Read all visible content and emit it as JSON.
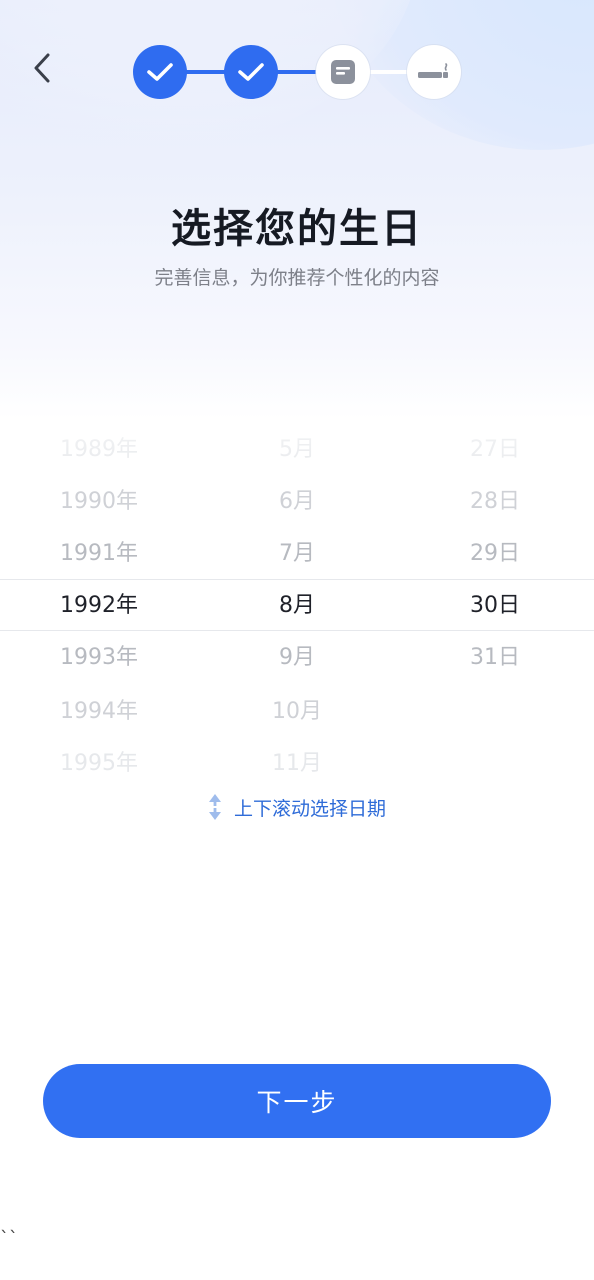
{
  "header": {
    "back_icon": "chevron-left-icon",
    "steps": [
      {
        "status": "done",
        "icon": "check-icon"
      },
      {
        "status": "done",
        "icon": "check-icon"
      },
      {
        "status": "current",
        "icon": "form-icon"
      },
      {
        "status": "todo",
        "icon": "cigarette-icon"
      }
    ]
  },
  "title": "选择您的生日",
  "subtitle": "完善信息，为你推荐个性化的内容",
  "picker": {
    "years": [
      "1989年",
      "1990年",
      "1991年",
      "1992年",
      "1993年",
      "1994年",
      "1995年"
    ],
    "months": [
      "5月",
      "6月",
      "7月",
      "8月",
      "9月",
      "10月",
      "11月"
    ],
    "days": [
      "27日",
      "28日",
      "29日",
      "30日",
      "31日"
    ],
    "selected": {
      "year": "1992年",
      "month": "8月",
      "day": "30日"
    }
  },
  "hint": {
    "icon": "scroll-updown-icon",
    "text": "上下滚动选择日期"
  },
  "next_button": {
    "label": "下一步"
  },
  "stray_text": "``",
  "colors": {
    "accent": "#3170f2",
    "hint": "#2f6cd8",
    "title": "#161a23",
    "subtitle": "#7d8089"
  }
}
